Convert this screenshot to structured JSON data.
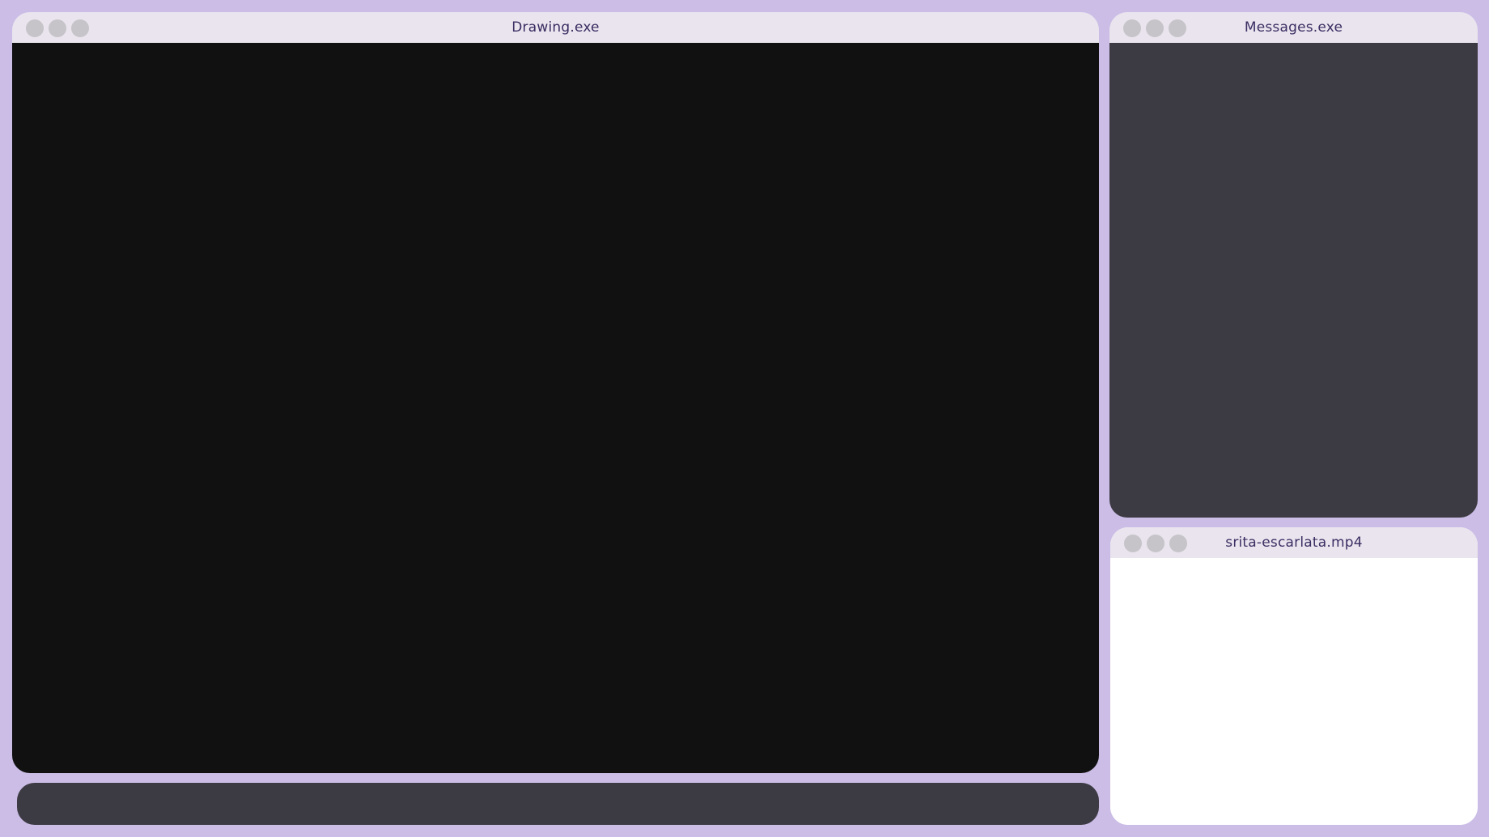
{
  "windows": {
    "drawing": {
      "title": "Drawing.exe"
    },
    "messages": {
      "title": "Messages.exe"
    },
    "video": {
      "title": "srita-escarlata.mp4"
    }
  },
  "colors": {
    "desktop_background": "#cbbde6",
    "titlebar": "#e9e4ee",
    "title_text": "#3b2f63",
    "window_buttons": "#c6c4c8",
    "drawing_canvas": "#111111",
    "messages_panel": "#3c3a42",
    "video_panel": "#ffffff",
    "bottom_bar": "#3c3a42"
  },
  "icons": [
    "window-button-icon"
  ]
}
